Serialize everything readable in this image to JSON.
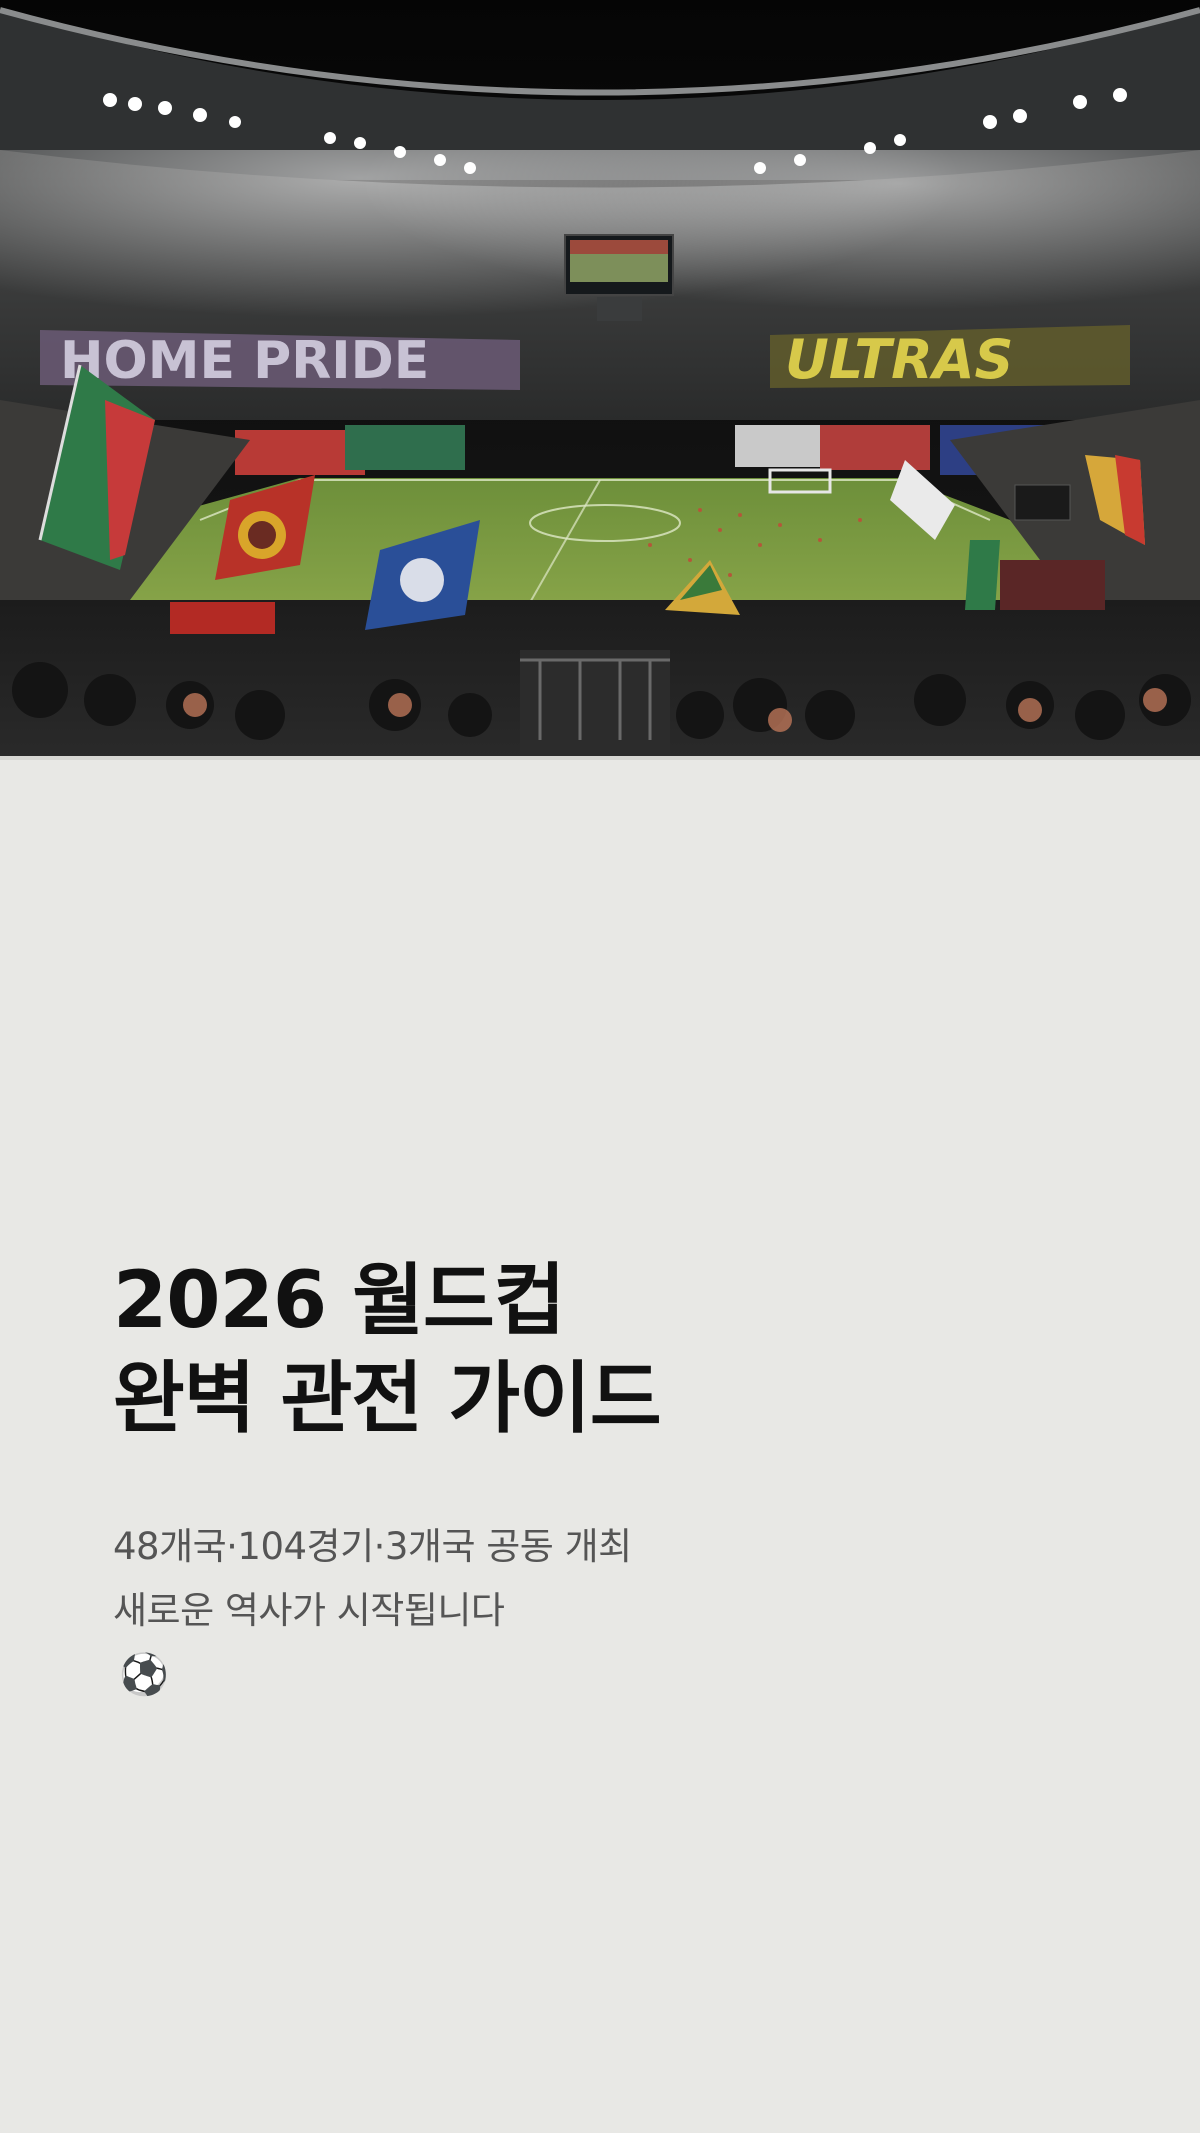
{
  "hero": {
    "banners": {
      "left": "HOME PRIDE",
      "right": "ULTRAS"
    }
  },
  "headline": {
    "line1": "2026 월드컵",
    "line2": "완벽 관전 가이드"
  },
  "subtitle": {
    "line1": "48개국·104경기·3개국 공동 개최",
    "line2": "새로운 역사가 시작됩니다",
    "icon": "soccer-ball-icon"
  }
}
